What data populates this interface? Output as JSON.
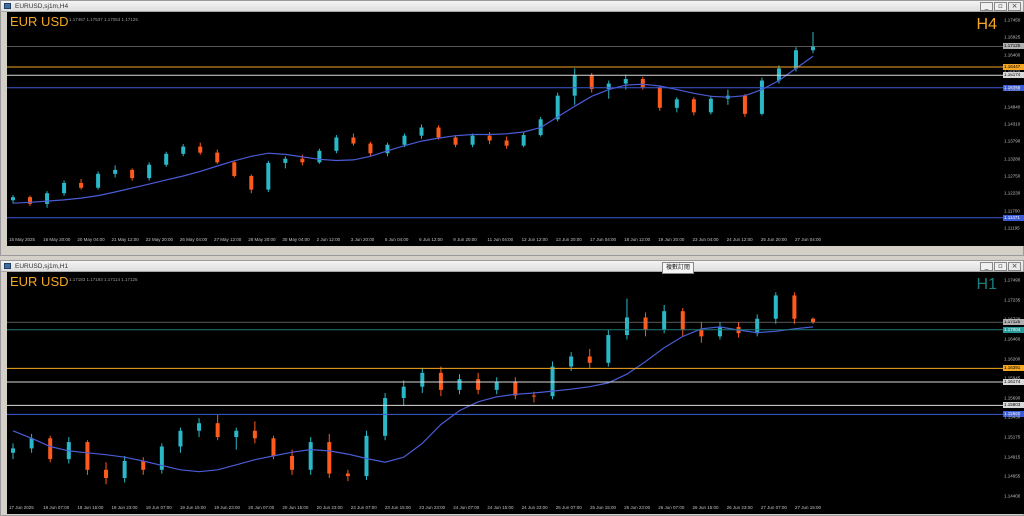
{
  "colors": {
    "bull": "#2ab8c8",
    "bear": "#ff5a1e",
    "ma": "#4a5cd6",
    "symbol": "#f5a623",
    "tf_h4": "#f5a623",
    "tf_h1": "#1a7d7d",
    "line_orange": "#f5a623",
    "line_white": "#d9d9d9",
    "line_blue": "#3b5bd6",
    "line_gray": "#8c8c8c"
  },
  "sync_tooltip": "複數訂閱",
  "windows": [
    {
      "id": "h4",
      "title": "EURUSD,sj1m,H4",
      "symbol": "EUR USD",
      "timeframe": "H4",
      "ohlc": "1.17467 1.17537 1.17053 1.17125",
      "price_labels": [
        "1.17450",
        "1.16925",
        "1.16400",
        "1.15870",
        "1.15350",
        "1.14840",
        "1.14310",
        "1.13790",
        "1.13280",
        "1.12750",
        "1.12230",
        "1.11700",
        "1.11195"
      ],
      "tags": [
        {
          "text": "1.17125",
          "style": "gray"
        },
        {
          "text": "1.16447",
          "style": "orange"
        },
        {
          "text": "1.16174",
          "style": "white"
        },
        {
          "text": "1.15760",
          "style": "blue"
        },
        {
          "text": "1.11471",
          "style": "blue"
        }
      ],
      "time_labels": [
        "15 May 2025",
        "16 May 20:00",
        "20 May 04:00",
        "21 May 12:00",
        "22 May 20:00",
        "26 May 04:00",
        "27 May 12:00",
        "28 May 20:00",
        "30 May 04:00",
        "2 Jun 12:00",
        "3 Jun 20:00",
        "5 Jun 04:00",
        "6 Jun 12:00",
        "9 Jun 20:00",
        "11 Jun 04:00",
        "12 Jun 12:00",
        "13 Jun 20:00",
        "17 Jun 04:00",
        "18 Jun 12:00",
        "19 Jun 20:00",
        "23 Jun 04:00",
        "24 Jun 12:00",
        "25 Jun 20:00",
        "27 Jun 04:00"
      ],
      "chart_data": {
        "type": "candlestick",
        "ylim": [
          1.11,
          1.178
        ],
        "series": [
          {
            "name": "MA",
            "values": [
              1.1195,
              1.1198,
              1.1202,
              1.1206,
              1.1212,
              1.122,
              1.1232,
              1.1245,
              1.1258,
              1.1272,
              1.1285,
              1.13,
              1.1318,
              1.1335,
              1.135,
              1.136,
              1.1356,
              1.1348,
              1.134,
              1.1336,
              1.1338,
              1.135,
              1.1368,
              1.1385,
              1.14,
              1.141,
              1.1418,
              1.1422,
              1.1422,
              1.1424,
              1.143,
              1.1445,
              1.148,
              1.1515,
              1.1548,
              1.157,
              1.1585,
              1.1588,
              1.1582,
              1.157,
              1.1558,
              1.1548,
              1.1545,
              1.155,
              1.157,
              1.16,
              1.164,
              1.168
            ]
          }
        ],
        "candles": [
          [
            1.1205,
            1.1222,
            1.1195,
            1.1215
          ],
          [
            1.1215,
            1.122,
            1.1186,
            1.1193
          ],
          [
            1.1193,
            1.1235,
            1.118,
            1.1228
          ],
          [
            1.1228,
            1.127,
            1.122,
            1.1262
          ],
          [
            1.1262,
            1.1275,
            1.124,
            1.1246
          ],
          [
            1.1246,
            1.13,
            1.124,
            1.1292
          ],
          [
            1.1292,
            1.132,
            1.128,
            1.1305
          ],
          [
            1.1305,
            1.131,
            1.127,
            1.1278
          ],
          [
            1.1278,
            1.133,
            1.127,
            1.1322
          ],
          [
            1.1322,
            1.1365,
            1.1315,
            1.1358
          ],
          [
            1.1358,
            1.139,
            1.135,
            1.1382
          ],
          [
            1.1382,
            1.1395,
            1.1355,
            1.1362
          ],
          [
            1.1362,
            1.1372,
            1.1325,
            1.133
          ],
          [
            1.133,
            1.1335,
            1.128,
            1.1285
          ],
          [
            1.1285,
            1.129,
            1.1228,
            1.124
          ],
          [
            1.124,
            1.1335,
            1.1232,
            1.1328
          ],
          [
            1.1328,
            1.135,
            1.131,
            1.1342
          ],
          [
            1.1342,
            1.1355,
            1.132,
            1.133
          ],
          [
            1.133,
            1.1375,
            1.1325,
            1.1368
          ],
          [
            1.1368,
            1.142,
            1.136,
            1.1412
          ],
          [
            1.1412,
            1.1425,
            1.1385,
            1.1392
          ],
          [
            1.1392,
            1.1398,
            1.135,
            1.136
          ],
          [
            1.136,
            1.1395,
            1.135,
            1.1388
          ],
          [
            1.1388,
            1.1425,
            1.138,
            1.1418
          ],
          [
            1.1418,
            1.1455,
            1.1408,
            1.1445
          ],
          [
            1.1445,
            1.1452,
            1.1405,
            1.1412
          ],
          [
            1.1412,
            1.142,
            1.138,
            1.1388
          ],
          [
            1.1388,
            1.1425,
            1.138,
            1.1418
          ],
          [
            1.1418,
            1.143,
            1.139,
            1.1402
          ],
          [
            1.1402,
            1.1415,
            1.1375,
            1.1385
          ],
          [
            1.1385,
            1.1428,
            1.138,
            1.142
          ],
          [
            1.142,
            1.148,
            1.1415,
            1.1472
          ],
          [
            1.1472,
            1.156,
            1.1465,
            1.155
          ],
          [
            1.155,
            1.164,
            1.152,
            1.1618
          ],
          [
            1.1618,
            1.1625,
            1.156,
            1.1572
          ],
          [
            1.1572,
            1.16,
            1.154,
            1.159
          ],
          [
            1.159,
            1.162,
            1.157,
            1.1605
          ],
          [
            1.1605,
            1.1612,
            1.157,
            1.1578
          ],
          [
            1.1578,
            1.1582,
            1.15,
            1.151
          ],
          [
            1.151,
            1.1545,
            1.1495,
            1.1538
          ],
          [
            1.1538,
            1.1545,
            1.1485,
            1.1495
          ],
          [
            1.1495,
            1.155,
            1.1488,
            1.154
          ],
          [
            1.154,
            1.157,
            1.152,
            1.155
          ],
          [
            1.155,
            1.1555,
            1.148,
            1.149
          ],
          [
            1.149,
            1.161,
            1.1485,
            1.16
          ],
          [
            1.16,
            1.165,
            1.159,
            1.164
          ],
          [
            1.164,
            1.171,
            1.163,
            1.17
          ],
          [
            1.17,
            1.176,
            1.169,
            1.1712
          ]
        ]
      }
    },
    {
      "id": "h1",
      "title": "EURUSD,sj1m,H1",
      "symbol": "EUR USD",
      "timeframe": "H1",
      "ohlc": "1.17183 1.17193 1.17114 1.17125",
      "price_labels": [
        "1.17490",
        "1.17235",
        "1.16720",
        "1.16460",
        "1.16200",
        "1.15945",
        "1.15690",
        "1.15430",
        "1.15175",
        "1.14915",
        "1.14655",
        "1.14400"
      ],
      "tags": [
        {
          "text": "1.17125",
          "style": "gray"
        },
        {
          "text": "1.17004",
          "style": "teal"
        },
        {
          "text": "1.16391",
          "style": "orange"
        },
        {
          "text": "1.16174",
          "style": "white"
        },
        {
          "text": "1.15803",
          "style": "white"
        },
        {
          "text": "1.15660",
          "style": "blue"
        }
      ],
      "time_labels": [
        "17 Jun 2025",
        "18 Jun 07:00",
        "18 Jun 15:00",
        "18 Jun 23:00",
        "19 Jun 07:00",
        "19 Jun 15:00",
        "19 Jun 23:00",
        "20 Jun 07:00",
        "20 Jun 15:00",
        "20 Jun 23:00",
        "23 Jun 07:00",
        "23 Jun 15:00",
        "23 Jun 23:00",
        "24 Jun 07:00",
        "24 Jun 15:00",
        "24 Jun 23:00",
        "25 Jun 07:00",
        "25 Jun 15:00",
        "25 Jun 23:00",
        "26 Jun 07:00",
        "26 Jun 15:00",
        "26 Jun 23:00",
        "27 Jun 07:00",
        "27 Jun 15:00"
      ],
      "chart_data": {
        "type": "candlestick",
        "ylim": [
          1.143,
          1.177
        ],
        "series": [
          {
            "name": "MA",
            "values": [
              1.154,
              1.1528,
              1.1515,
              1.1508,
              1.1505,
              1.1502,
              1.1498,
              1.1492,
              1.1485,
              1.1478,
              1.1475,
              1.1478,
              1.1486,
              1.1494,
              1.15,
              1.1506,
              1.151,
              1.1508,
              1.1503,
              1.1496,
              1.149,
              1.1498,
              1.152,
              1.155,
              1.1572,
              1.1586,
              1.1594,
              1.1598,
              1.16,
              1.1603,
              1.1606,
              1.161,
              1.1616,
              1.163,
              1.165,
              1.1672,
              1.169,
              1.1702,
              1.1705,
              1.17,
              1.1696,
              1.1698,
              1.1702,
              1.1705
            ]
          }
        ],
        "candles": [
          [
            1.1505,
            1.152,
            1.1495,
            1.1512
          ],
          [
            1.1512,
            1.1535,
            1.1505,
            1.1528
          ],
          [
            1.1528,
            1.1532,
            1.149,
            1.1495
          ],
          [
            1.1495,
            1.153,
            1.1488,
            1.1522
          ],
          [
            1.1522,
            1.1525,
            1.147,
            1.1478
          ],
          [
            1.1478,
            1.149,
            1.1455,
            1.1465
          ],
          [
            1.1465,
            1.15,
            1.1458,
            1.1492
          ],
          [
            1.1492,
            1.1498,
            1.147,
            1.1478
          ],
          [
            1.1478,
            1.152,
            1.1472,
            1.1515
          ],
          [
            1.1515,
            1.1545,
            1.1505,
            1.154
          ],
          [
            1.154,
            1.156,
            1.153,
            1.1552
          ],
          [
            1.1552,
            1.1565,
            1.1525,
            1.153
          ],
          [
            1.153,
            1.1545,
            1.151,
            1.154
          ],
          [
            1.154,
            1.1555,
            1.152,
            1.1528
          ],
          [
            1.1528,
            1.1532,
            1.1495,
            1.15
          ],
          [
            1.15,
            1.151,
            1.147,
            1.1478
          ],
          [
            1.1478,
            1.153,
            1.147,
            1.1522
          ],
          [
            1.1522,
            1.1535,
            1.1465,
            1.1472
          ],
          [
            1.1472,
            1.1478,
            1.146,
            1.1468
          ],
          [
            1.1468,
            1.154,
            1.1462,
            1.1532
          ],
          [
            1.1532,
            1.16,
            1.1525,
            1.1592
          ],
          [
            1.1592,
            1.162,
            1.158,
            1.161
          ],
          [
            1.161,
            1.164,
            1.16,
            1.1632
          ],
          [
            1.1632,
            1.1642,
            1.1595,
            1.1605
          ],
          [
            1.1605,
            1.163,
            1.1598,
            1.1622
          ],
          [
            1.1622,
            1.1632,
            1.1598,
            1.1605
          ],
          [
            1.1605,
            1.1625,
            1.1598,
            1.1618
          ],
          [
            1.1618,
            1.1625,
            1.159,
            1.1596
          ],
          [
            1.1596,
            1.1602,
            1.1585,
            1.1595
          ],
          [
            1.1595,
            1.165,
            1.159,
            1.1642
          ],
          [
            1.1642,
            1.1665,
            1.1635,
            1.1658
          ],
          [
            1.1658,
            1.167,
            1.164,
            1.1648
          ],
          [
            1.1648,
            1.17,
            1.1642,
            1.1692
          ],
          [
            1.1692,
            1.175,
            1.1685,
            1.172
          ],
          [
            1.172,
            1.1728,
            1.169,
            1.17
          ],
          [
            1.17,
            1.174,
            1.1695,
            1.173
          ],
          [
            1.173,
            1.1735,
            1.169,
            1.17
          ],
          [
            1.17,
            1.1712,
            1.168,
            1.169
          ],
          [
            1.169,
            1.1712,
            1.1685,
            1.1705
          ],
          [
            1.1705,
            1.1712,
            1.1688,
            1.1695
          ],
          [
            1.1695,
            1.1725,
            1.169,
            1.1718
          ],
          [
            1.1718,
            1.176,
            1.171,
            1.1755
          ],
          [
            1.1755,
            1.176,
            1.171,
            1.1718
          ],
          [
            1.1718,
            1.172,
            1.171,
            1.1712
          ]
        ]
      }
    }
  ]
}
